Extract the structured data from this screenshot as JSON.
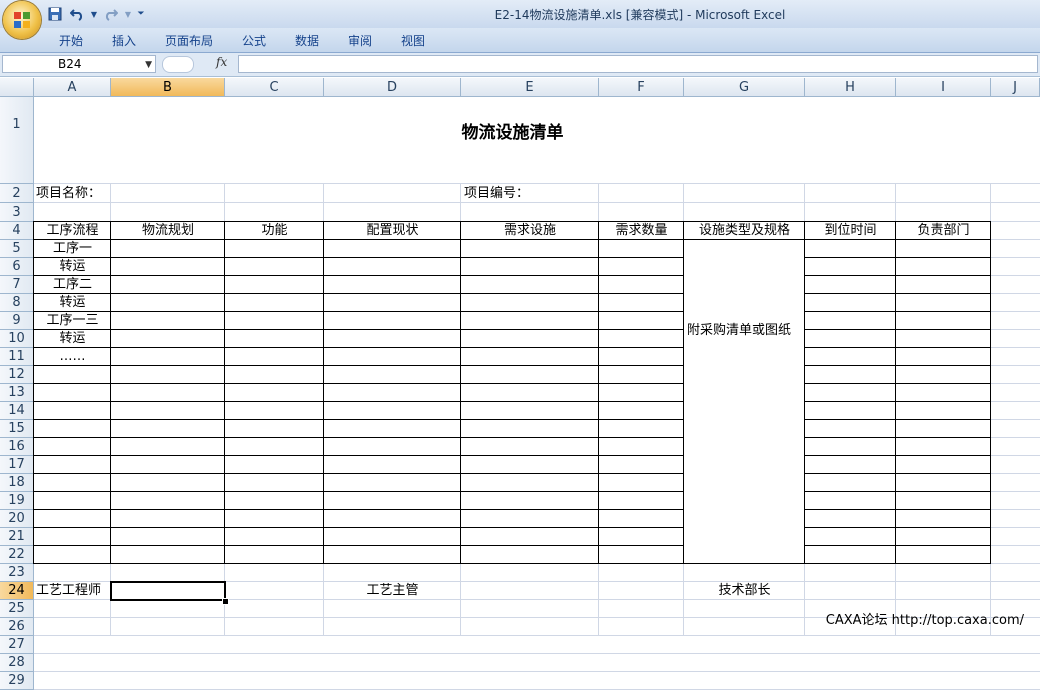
{
  "window": {
    "title": "E2-14物流设施清单.xls  [兼容模式] - Microsoft Excel"
  },
  "ribbon": {
    "tabs": [
      "开始",
      "插入",
      "页面布局",
      "公式",
      "数据",
      "审阅",
      "视图"
    ]
  },
  "formula_bar": {
    "name_box": "B24",
    "fx_label": "fx",
    "formula": ""
  },
  "sheet": {
    "columns": [
      "A",
      "B",
      "C",
      "D",
      "E",
      "F",
      "G",
      "H",
      "I",
      "J"
    ],
    "rows": [
      "1",
      "2",
      "3",
      "4",
      "5",
      "6",
      "7",
      "8",
      "9",
      "10",
      "11",
      "12",
      "13",
      "14",
      "15",
      "16",
      "17",
      "18",
      "19",
      "20",
      "21",
      "22",
      "23",
      "24",
      "25",
      "26",
      "27",
      "28",
      "29"
    ],
    "selected_column": "B",
    "selected_row": "24",
    "title": "物流设施清单",
    "project_name_label": "项目名称：",
    "project_no_label": "项目编号：",
    "headers": [
      "工序流程",
      "物流规划",
      "功能",
      "配置现状",
      "需求设施",
      "需求数量",
      "设施类型及规格",
      "到位时间",
      "负责部门"
    ],
    "process_items": [
      "工序一",
      "转运",
      "工序二",
      "转运",
      "工序一三",
      "转运",
      "……"
    ],
    "merged_note": "附采购清单或图纸",
    "signatures": [
      "工艺工程师",
      "工艺主管",
      "技术部长"
    ]
  },
  "watermark": "CAXA论坛  http://top.caxa.com/"
}
